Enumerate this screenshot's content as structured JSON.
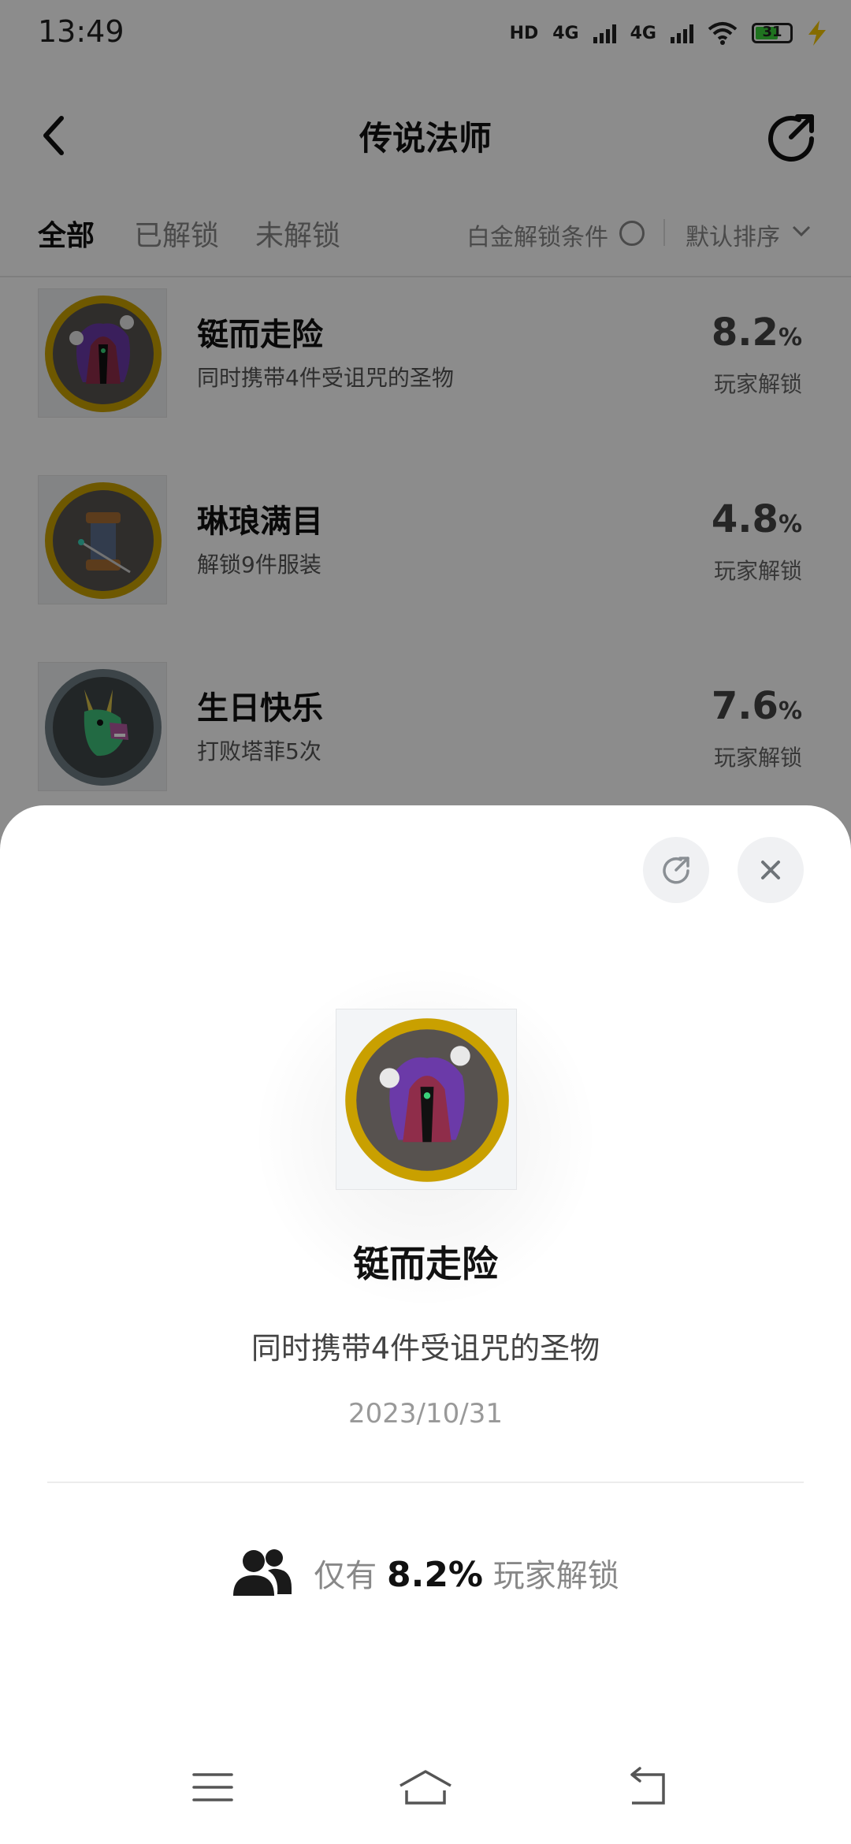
{
  "status_bar": {
    "time": "13:49",
    "hd_label": "HD",
    "signal_1_label": "4G",
    "signal_2_label": "4G",
    "battery_level": "31"
  },
  "header": {
    "title": "传说法师"
  },
  "tabs": [
    {
      "label": "全部",
      "active": true
    },
    {
      "label": "已解锁",
      "active": false
    },
    {
      "label": "未解锁",
      "active": false
    }
  ],
  "filters": {
    "platinum_label": "白金解锁条件",
    "sort_label": "默认排序"
  },
  "achievements": [
    {
      "title": "铤而走险",
      "desc": "同时携带4件受诅咒的圣物",
      "percent": "8.2",
      "percent_unit": "%",
      "percent_label": "玩家解锁"
    },
    {
      "title": "琳琅满目",
      "desc": "解锁9件服装",
      "percent": "4.8",
      "percent_unit": "%",
      "percent_label": "玩家解锁"
    },
    {
      "title": "生日快乐",
      "desc": "打败塔菲5次",
      "percent": "7.6",
      "percent_unit": "%",
      "percent_label": "玩家解锁"
    }
  ],
  "detail": {
    "title": "铤而走险",
    "desc": "同时携带4件受诅咒的圣物",
    "date": "2023/10/31",
    "stat_prefix": "仅有",
    "stat_value": "8.2%",
    "stat_suffix": "玩家解锁"
  },
  "colors": {
    "gold_ring": "#c9a000",
    "silver_ring": "#6e7c83",
    "badge_bg": "#57524f",
    "cloak": "#8f2d4a",
    "flame": "#6b3aa8"
  }
}
